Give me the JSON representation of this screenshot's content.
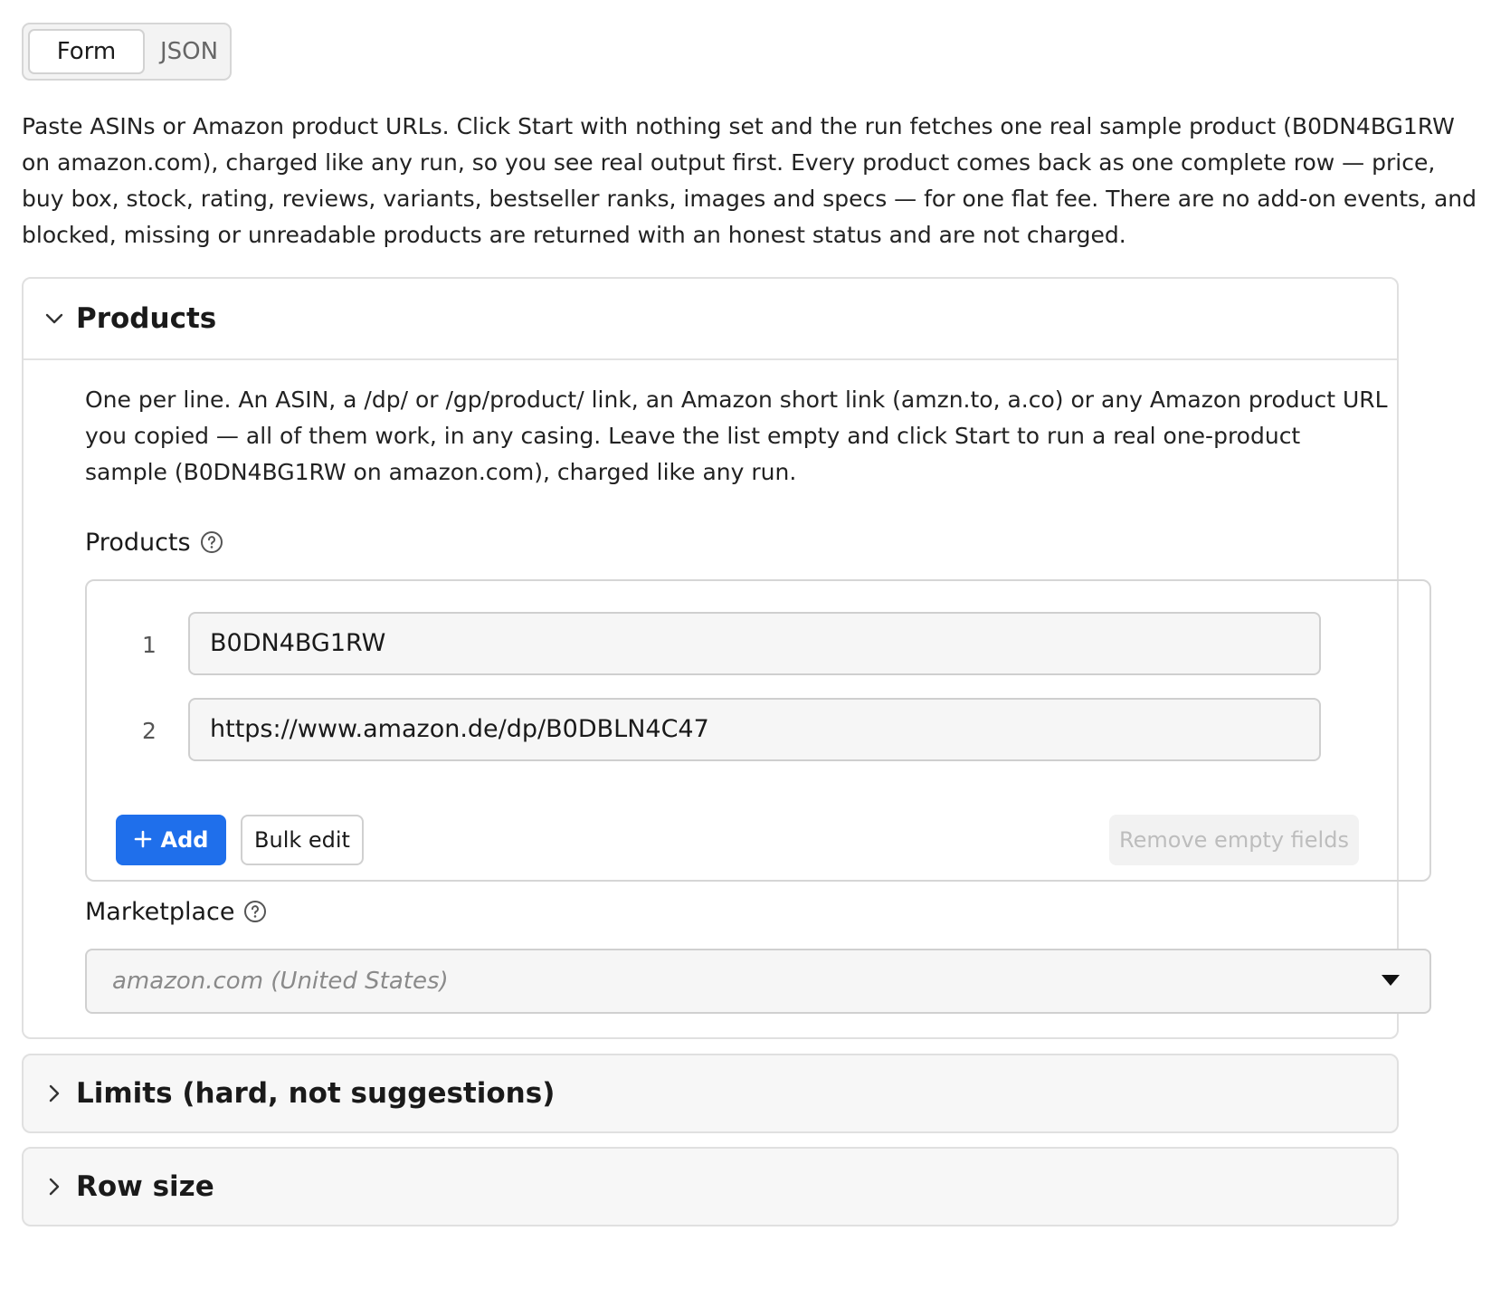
{
  "mode_toggle": {
    "form_label": "Form",
    "json_label": "JSON",
    "selected": "Form"
  },
  "intro_text": "Paste ASINs or Amazon product URLs. Click Start with nothing set and the run fetches one real sample product (B0DN4BG1RW on amazon.com), charged like any run, so you see real output first. Every product comes back as one complete row — price, buy box, stock, rating, reviews, variants, bestseller ranks, images and specs — for one flat fee. There are no add-on events, and blocked, missing or unreadable products are returned with an honest status and are not charged.",
  "products_section": {
    "title": "Products",
    "description": "One per line. An ASIN, a /dp/ or /gp/product/ link, an Amazon short link (amzn.to, a.co) or any Amazon product URL you copied — all of them work, in any casing. Leave the list empty and click Start to run a real one-product sample (B0DN4BG1RW on amazon.com), charged like any run.",
    "products_field": {
      "label": "Products",
      "help_icon": "question-circle-icon",
      "items": [
        {
          "index": "1",
          "value": "B0DN4BG1RW"
        },
        {
          "index": "2",
          "value": "https://www.amazon.de/dp/B0DBLN4C47"
        }
      ],
      "add_label": "Add",
      "bulk_edit_label": "Bulk edit",
      "remove_empty_label": "Remove empty fields"
    },
    "marketplace_field": {
      "label": "Marketplace",
      "help_icon": "question-circle-icon",
      "placeholder": "amazon.com (United States)"
    }
  },
  "limits_section": {
    "title": "Limits (hard, not suggestions)"
  },
  "row_size_section": {
    "title": "Row size"
  },
  "colors": {
    "accent": "#1f6feb",
    "border": "#d6d6d6",
    "disabled_text": "#bdbdbd"
  }
}
